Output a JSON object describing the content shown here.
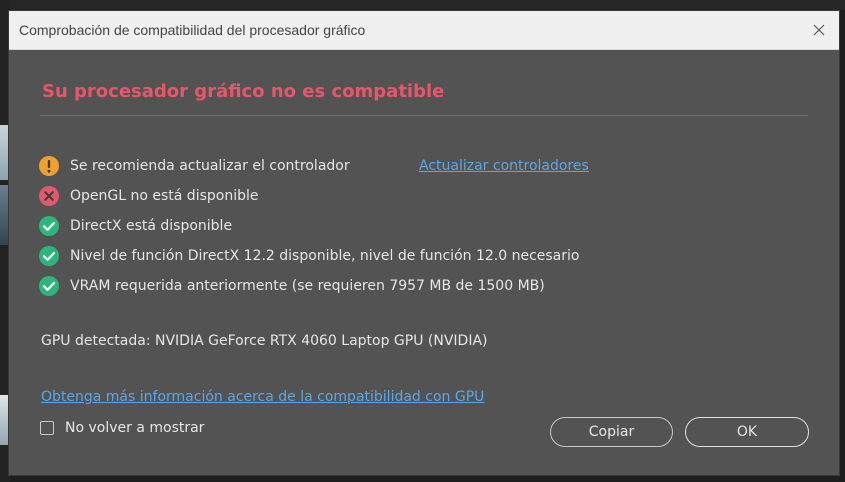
{
  "dialog": {
    "title": "Comprobación de compatibilidad del procesador gráfico",
    "heading": "Su procesador gráfico no es compatible",
    "checks": [
      {
        "status": "warning",
        "icon": "warning-icon",
        "color": "#f0a02e",
        "text": "Se recomienda actualizar el controlador"
      },
      {
        "status": "error",
        "icon": "error-icon",
        "color": "#e05a6e",
        "text": "OpenGL no está disponible"
      },
      {
        "status": "ok",
        "icon": "check-icon",
        "color": "#2db57e",
        "text": "DirectX está disponible"
      },
      {
        "status": "ok",
        "icon": "check-icon",
        "color": "#2db57e",
        "text": "Nivel de función DirectX 12.2 disponible, nivel de función 12.0 necesario"
      },
      {
        "status": "ok",
        "icon": "check-icon",
        "color": "#2db57e",
        "text": "VRAM requerida anteriormente (se requieren 7957 MB de 1500 MB)"
      }
    ],
    "update_link": "Actualizar controladores",
    "gpu_detected": "GPU detectada: NVIDIA GeForce RTX 4060 Laptop GPU (NVIDIA)",
    "info_link": "Obtenga más información acerca de la compatibilidad con GPU",
    "dont_show_label": "No volver a mostrar",
    "dont_show_checked": false,
    "copy_button": "Copiar",
    "ok_button": "OK"
  },
  "colors": {
    "heading": "#e8566a",
    "link": "#5ba6e8",
    "dialog_bg": "#535353"
  }
}
